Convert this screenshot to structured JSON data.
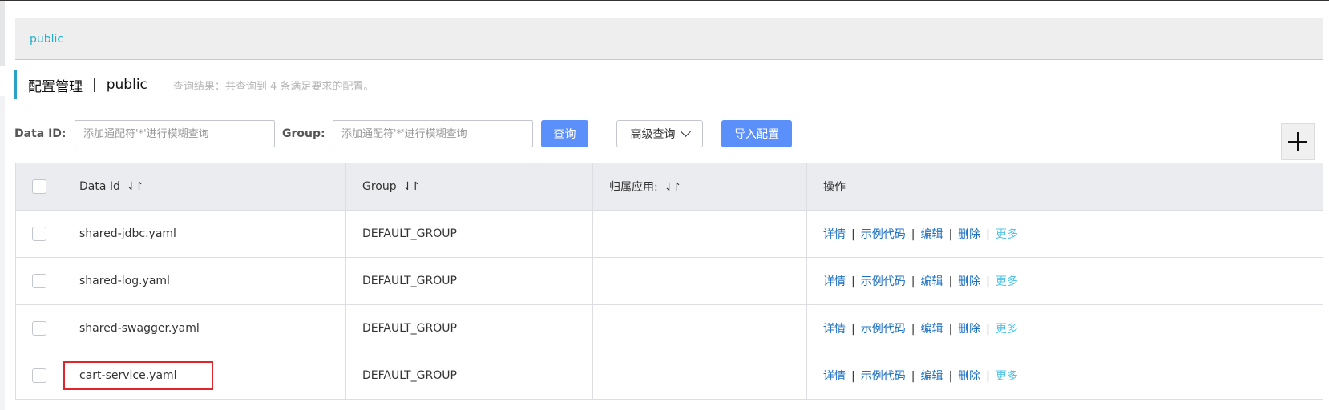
{
  "namespace_bar": {
    "link": "public"
  },
  "title": {
    "main": "配置管理",
    "separator": "|",
    "namespace": "public",
    "description": "查询结果：共查询到 4 条满足要求的配置。"
  },
  "filter": {
    "data_id_label": "Data ID:",
    "data_id_placeholder": "添加通配符'*'进行模糊查询",
    "group_label": "Group:",
    "group_placeholder": "添加通配符'*'进行模糊查询",
    "query_button": "查询",
    "advanced_button": "高级查询",
    "import_button": "导入配置"
  },
  "table": {
    "columns": [
      "Data Id",
      "Group",
      "归属应用:",
      "操作"
    ],
    "sort_icon": "⇃↾",
    "rows": [
      {
        "data_id": "shared-jdbc.yaml",
        "group": "DEFAULT_GROUP",
        "app": ""
      },
      {
        "data_id": "shared-log.yaml",
        "group": "DEFAULT_GROUP",
        "app": ""
      },
      {
        "data_id": "shared-swagger.yaml",
        "group": "DEFAULT_GROUP",
        "app": ""
      },
      {
        "data_id": "cart-service.yaml",
        "group": "DEFAULT_GROUP",
        "app": ""
      }
    ],
    "actions": {
      "detail": "详情",
      "sample": "示例代码",
      "edit": "编辑",
      "delete": "删除",
      "more": "更多",
      "sep": "|"
    }
  },
  "colors": {
    "primary": "#5b8ff9",
    "link": "#1a6fc4",
    "highlight_border": "#e0262c",
    "accent": "#29a3c4"
  }
}
